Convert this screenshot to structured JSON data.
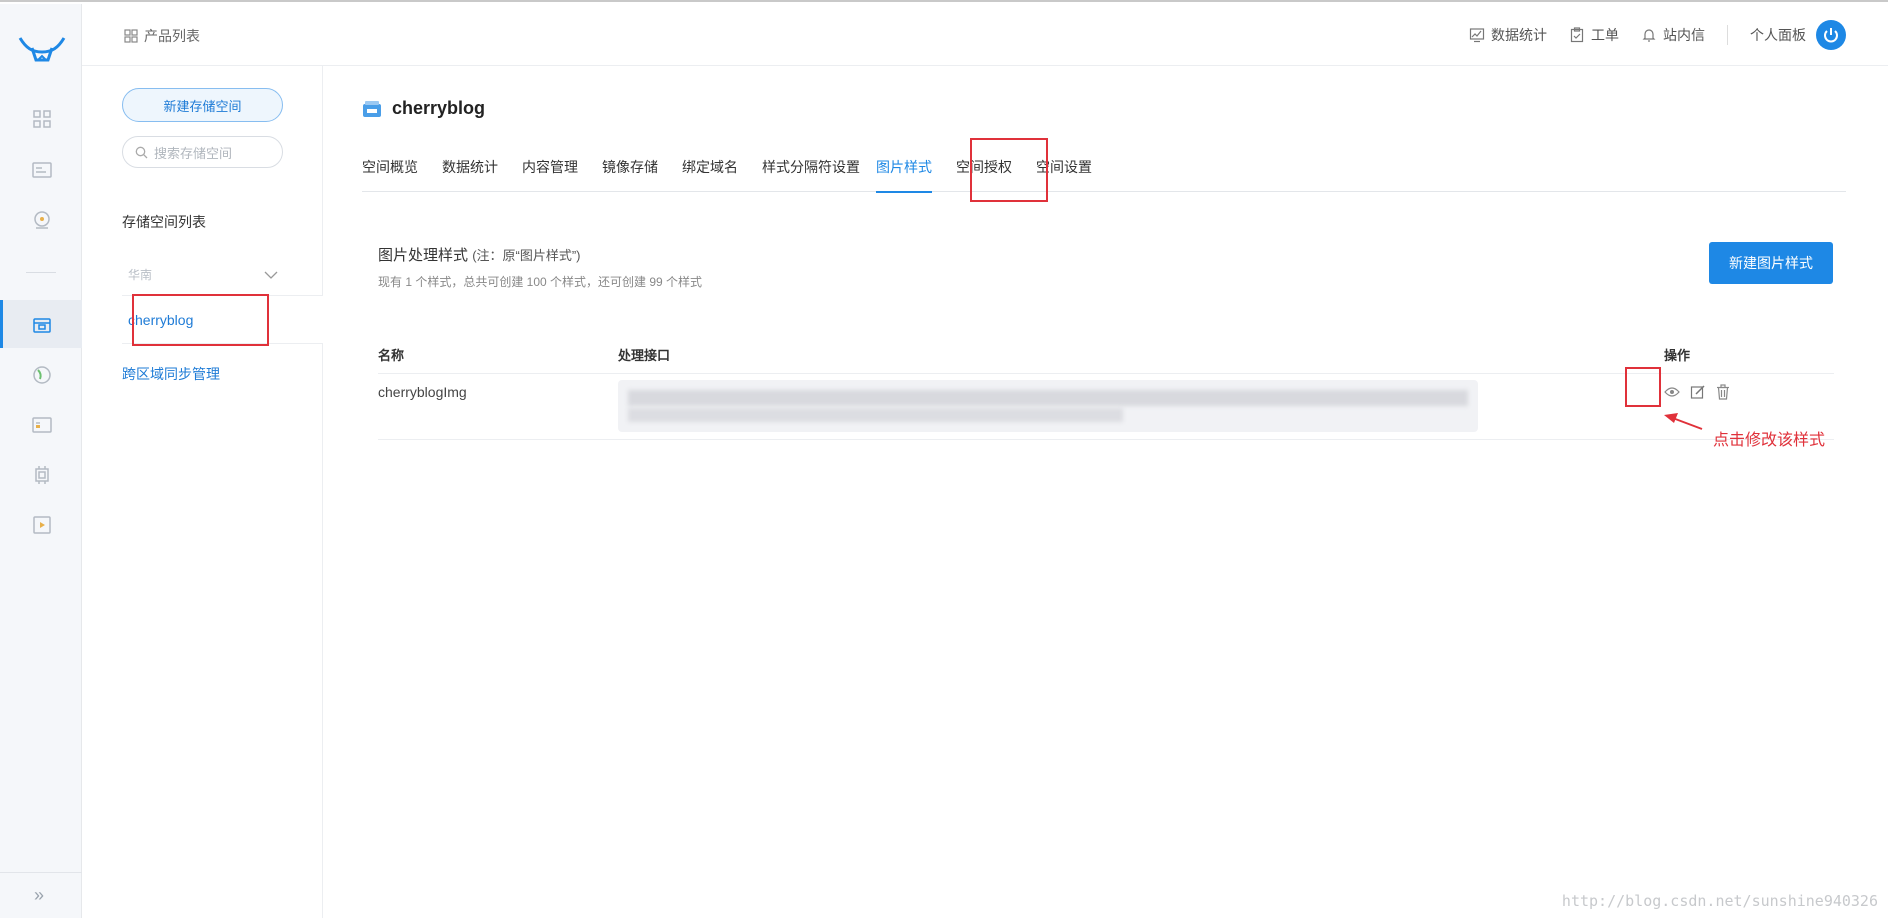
{
  "header": {
    "breadcrumb": "产品列表",
    "nav": [
      {
        "label": "数据统计",
        "icon": "chart-icon"
      },
      {
        "label": "工单",
        "icon": "clipboard-icon"
      },
      {
        "label": "站内信",
        "icon": "bell-icon"
      }
    ],
    "profile_label": "个人面板"
  },
  "sidebar": {
    "new_bucket_label": "新建存储空间",
    "search_placeholder": "搜索存储空间",
    "list_title": "存储空间列表",
    "region": "华南",
    "bucket_name": "cherryblog",
    "cross_region_label": "跨区域同步管理"
  },
  "main": {
    "bucket_title": "cherryblog",
    "tabs": [
      "空间概览",
      "数据统计",
      "内容管理",
      "镜像存储",
      "绑定域名",
      "样式分隔符设置",
      "图片样式",
      "空间授权",
      "空间设置"
    ],
    "active_tab": "图片样式",
    "section_title": "图片处理样式",
    "section_note": "(注：原“图片样式”)",
    "section_sub": "现有 1 个样式，总共可创建 100 个样式，还可创建 99 个样式",
    "new_style_label": "新建图片样式",
    "table": {
      "headers": [
        "名称",
        "处理接口",
        "操作"
      ],
      "rows": [
        {
          "name": "cherryblogImg"
        }
      ]
    },
    "annotation": "点击修改该样式"
  },
  "watermark": "http://blog.csdn.net/sunshine940326",
  "colors": {
    "accent": "#1e88e5",
    "highlight": "#e0313a"
  }
}
